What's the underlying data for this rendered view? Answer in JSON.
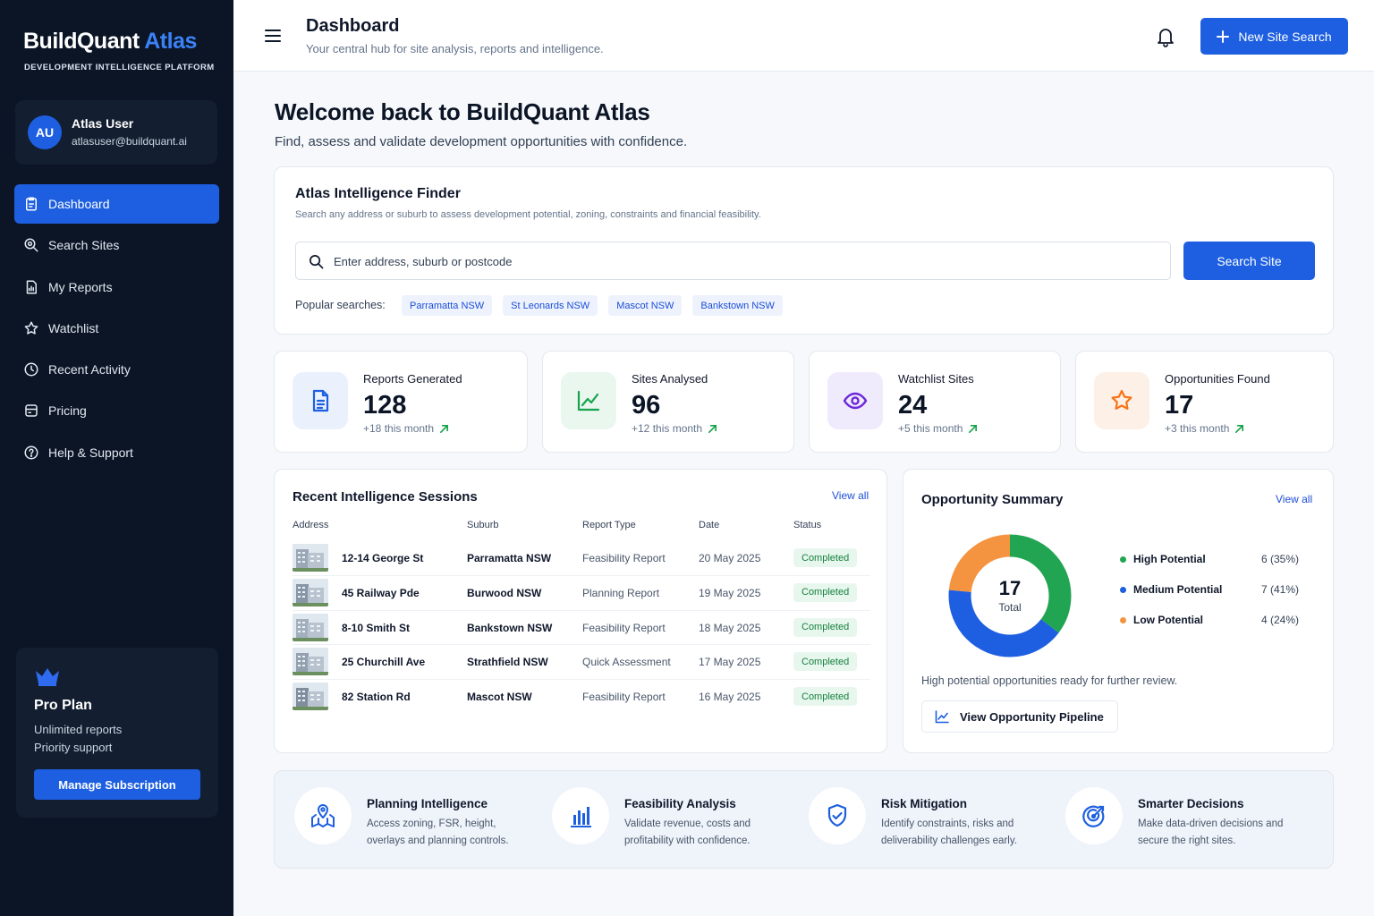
{
  "brand": {
    "name_part1": "BuildQuant",
    "name_part2": "Atlas",
    "tagline": "DEVELOPMENT INTELLIGENCE PLATFORM"
  },
  "user": {
    "initials": "AU",
    "name": "Atlas User",
    "email": "atlasuser@buildquant.ai"
  },
  "nav": [
    {
      "label": "Dashboard",
      "icon": "dashboard-icon",
      "active": true
    },
    {
      "label": "Search Sites",
      "icon": "search-sites-icon",
      "active": false
    },
    {
      "label": "My Reports",
      "icon": "reports-icon",
      "active": false
    },
    {
      "label": "Watchlist",
      "icon": "star-icon",
      "active": false
    },
    {
      "label": "Recent Activity",
      "icon": "clock-icon",
      "active": false
    },
    {
      "label": "Pricing",
      "icon": "pricing-icon",
      "active": false
    },
    {
      "label": "Help & Support",
      "icon": "help-icon",
      "active": false
    }
  ],
  "plan": {
    "title": "Pro Plan",
    "feature1": "Unlimited reports",
    "feature2": "Priority support",
    "button": "Manage Subscription"
  },
  "header": {
    "title": "Dashboard",
    "subtitle": "Your central hub for site analysis, reports and intelligence.",
    "new_button": "New Site Search"
  },
  "welcome": {
    "title": "Welcome back to BuildQuant Atlas",
    "subtitle": "Find, assess and validate development opportunities with confidence."
  },
  "finder": {
    "title": "Atlas Intelligence Finder",
    "subtitle": "Search any address or suburb to assess development potential, zoning, constraints and financial feasibility.",
    "placeholder": "Enter address, suburb or postcode",
    "button": "Search Site",
    "popular_label": "Popular searches:",
    "popular": [
      "Parramatta NSW",
      "St Leonards NSW",
      "Mascot NSW",
      "Bankstown NSW"
    ]
  },
  "stats": [
    {
      "label": "Reports Generated",
      "value": "128",
      "delta": "+18 this month",
      "icon": "document-icon",
      "color": "#1d5fe0",
      "bg": "#eaf1fd"
    },
    {
      "label": "Sites Analysed",
      "value": "96",
      "delta": "+12 this month",
      "icon": "chart-line-icon",
      "color": "#16a34a",
      "bg": "#e9f7ef"
    },
    {
      "label": "Watchlist Sites",
      "value": "24",
      "delta": "+5 this month",
      "icon": "eye-icon",
      "color": "#6d28d9",
      "bg": "#f0ebfc"
    },
    {
      "label": "Opportunities Found",
      "value": "17",
      "delta": "+3 this month",
      "icon": "star-icon",
      "color": "#f97316",
      "bg": "#fdf0e6"
    }
  ],
  "sessions": {
    "title": "Recent Intelligence Sessions",
    "view_all": "View all",
    "columns": [
      "Address",
      "Suburb",
      "Report Type",
      "Date",
      "Status"
    ],
    "rows": [
      {
        "address": "12-14 George St",
        "suburb": "Parramatta NSW",
        "type": "Feasibility Report",
        "date": "20 May 2025",
        "status": "Completed"
      },
      {
        "address": "45 Railway Pde",
        "suburb": "Burwood NSW",
        "type": "Planning Report",
        "date": "19 May 2025",
        "status": "Completed"
      },
      {
        "address": "8-10 Smith St",
        "suburb": "Bankstown NSW",
        "type": "Feasibility Report",
        "date": "18 May 2025",
        "status": "Completed"
      },
      {
        "address": "25 Churchill Ave",
        "suburb": "Strathfield NSW",
        "type": "Quick Assessment",
        "date": "17 May 2025",
        "status": "Completed"
      },
      {
        "address": "82 Station Rd",
        "suburb": "Mascot NSW",
        "type": "Feasibility Report",
        "date": "16 May 2025",
        "status": "Completed"
      }
    ]
  },
  "opportunity": {
    "title": "Opportunity Summary",
    "view_all": "View all",
    "total": "17",
    "total_label": "Total",
    "segments": [
      {
        "name": "High Potential",
        "count": 6,
        "value_text": "6 (35%)",
        "color": "#22a553"
      },
      {
        "name": "Medium Potential",
        "count": 7,
        "value_text": "7 (41%)",
        "color": "#1d5fe0"
      },
      {
        "name": "Low Potential",
        "count": 4,
        "value_text": "4 (24%)",
        "color": "#f59440"
      }
    ],
    "note": "High potential opportunities ready for further review.",
    "button": "View Opportunity Pipeline"
  },
  "features": [
    {
      "title": "Planning Intelligence",
      "line1": "Access zoning, FSR, height,",
      "line2": "overlays and planning controls.",
      "icon": "planning-icon"
    },
    {
      "title": "Feasibility Analysis",
      "line1": "Validate revenue, costs and",
      "line2": "profitability with confidence.",
      "icon": "bar-chart-icon"
    },
    {
      "title": "Risk Mitigation",
      "line1": "Identify constraints, risks and",
      "line2": "deliverability challenges early.",
      "icon": "shield-icon"
    },
    {
      "title": "Smarter Decisions",
      "line1": "Make data-driven decisions and",
      "line2": "secure the right sites.",
      "icon": "target-icon"
    }
  ]
}
